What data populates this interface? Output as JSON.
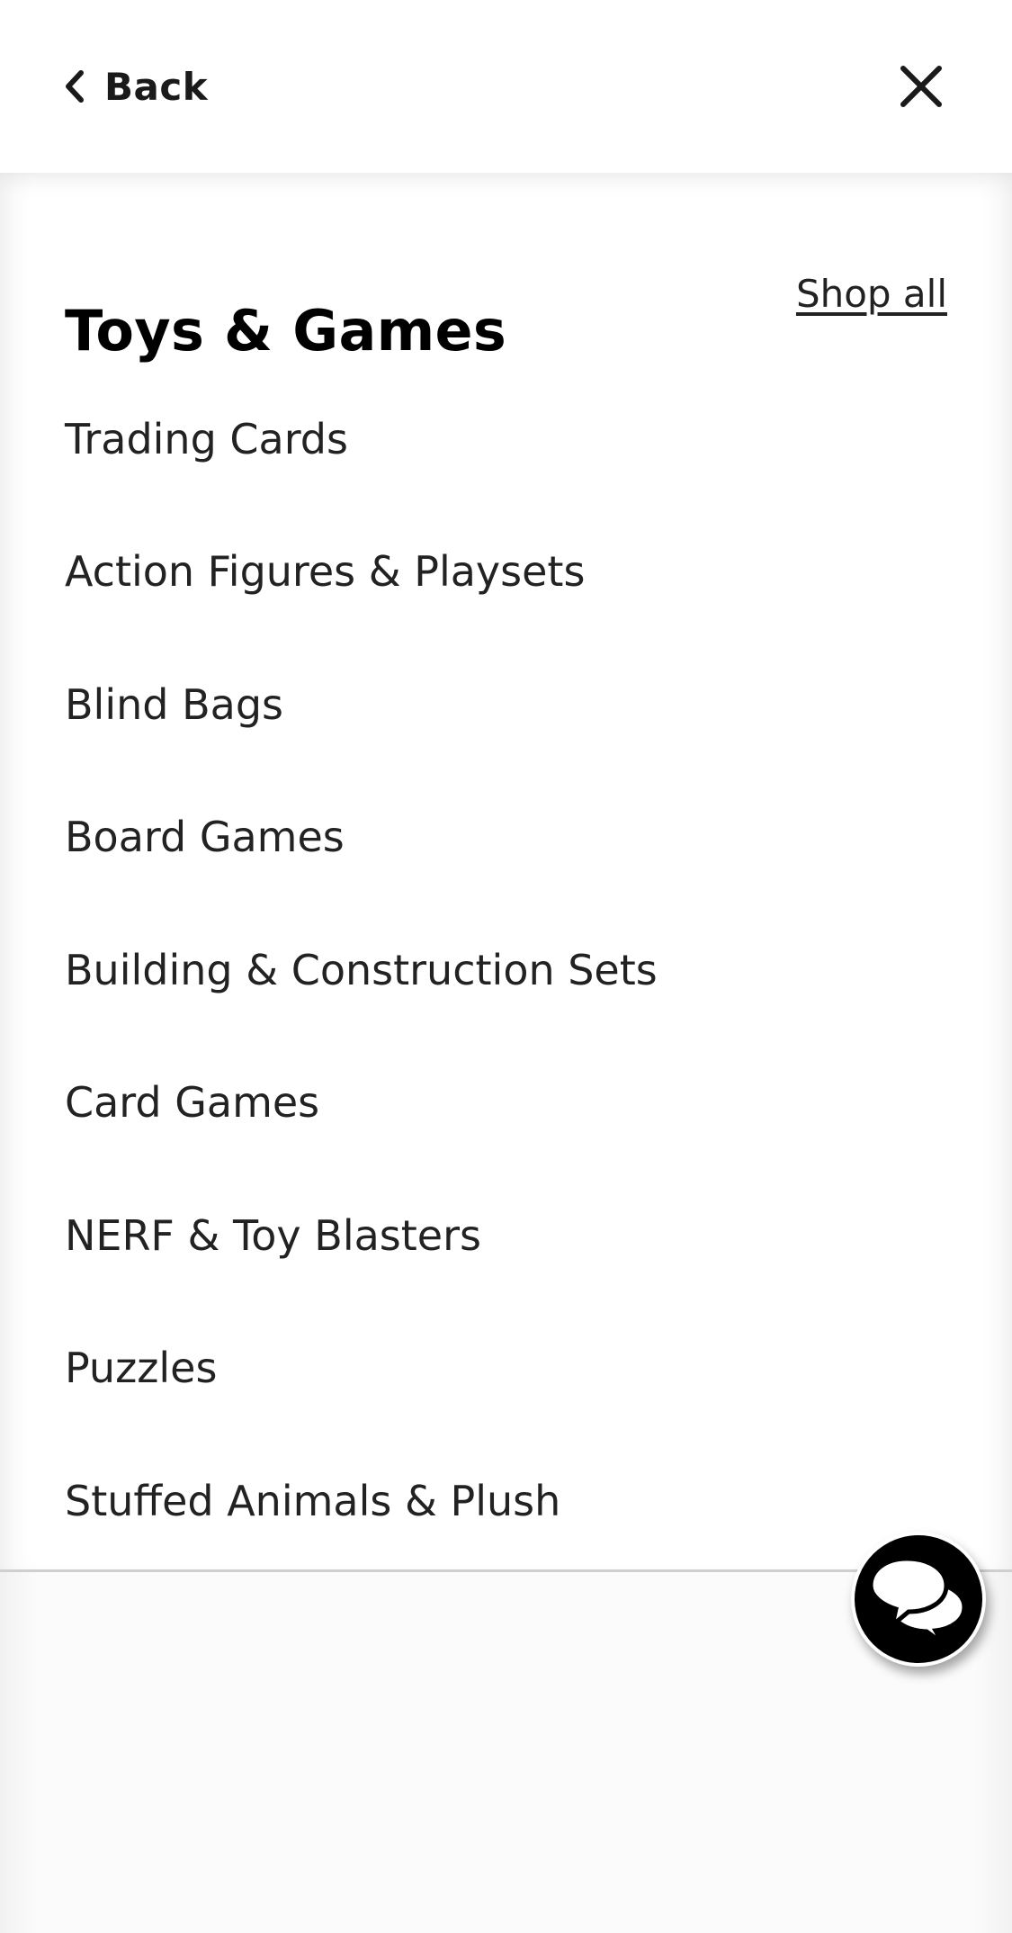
{
  "header": {
    "back_label": "Back",
    "back_icon": "chevron-left-icon",
    "close_icon": "close-icon"
  },
  "menu": {
    "title": "Toys & Games",
    "shop_all_label": "Shop all",
    "items": [
      "Trading Cards",
      "Action Figures & Playsets",
      "Blind Bags",
      "Board Games",
      "Building & Construction Sets",
      "Card Games",
      "NERF & Toy Blasters",
      "Puzzles",
      "Stuffed Animals & Plush"
    ]
  },
  "chat": {
    "icon": "chat-bubbles-icon"
  },
  "colors": {
    "text": "#222222",
    "title": "#000000",
    "background": "#ffffff",
    "chat_button": "#000000"
  }
}
